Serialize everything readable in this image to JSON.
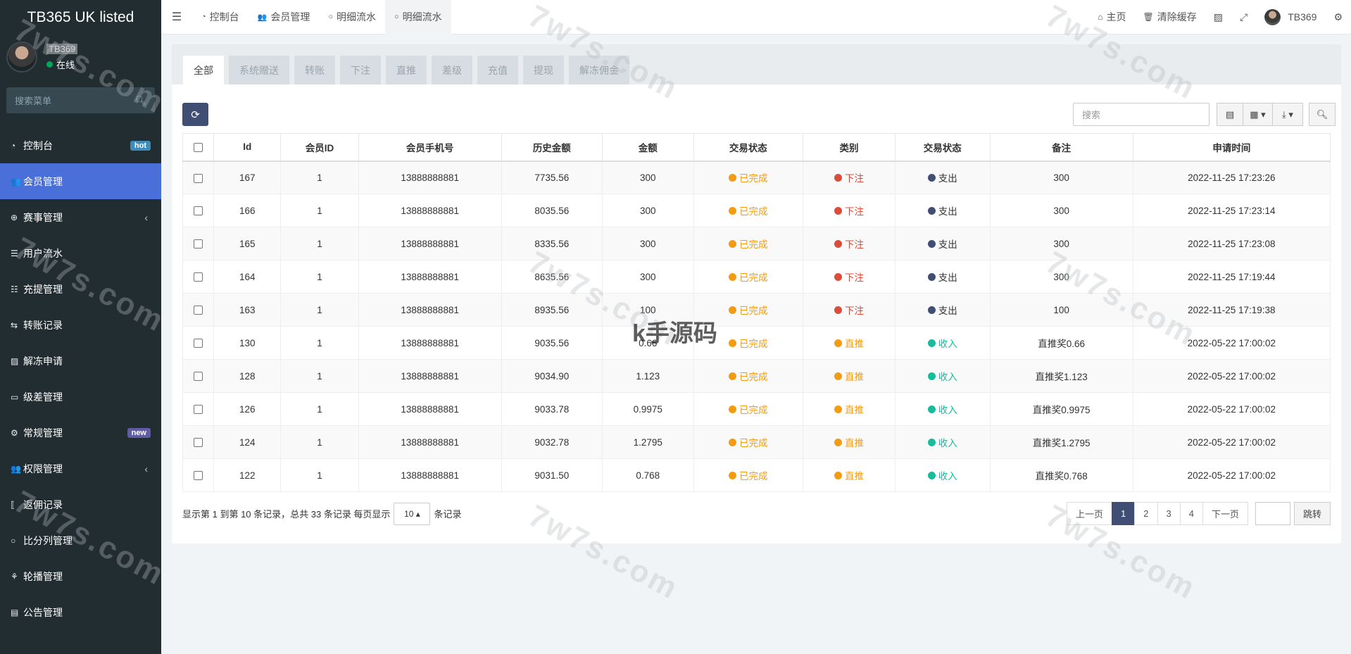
{
  "sidebar": {
    "brand": "TB365 UK listed",
    "user": {
      "name": "TB369",
      "status": "在线"
    },
    "search_placeholder": "搜索菜单",
    "items": [
      {
        "label": "控制台",
        "icon": "dashboard-icon",
        "glyph": "◔",
        "badge": "hot",
        "badge_type": "hot",
        "active": false,
        "chevron": false
      },
      {
        "label": "会员管理",
        "icon": "users-icon",
        "glyph": "👥",
        "badge": "",
        "active": true,
        "chevron": false
      },
      {
        "label": "赛事管理",
        "icon": "globe-icon",
        "glyph": "⊕",
        "badge": "",
        "active": false,
        "chevron": true
      },
      {
        "label": "用户流水",
        "icon": "list-icon",
        "glyph": "☰",
        "badge": "",
        "active": false,
        "chevron": false
      },
      {
        "label": "充提管理",
        "icon": "list-ordered-icon",
        "glyph": "☷",
        "badge": "",
        "active": false,
        "chevron": false
      },
      {
        "label": "转账记录",
        "icon": "transfer-icon",
        "glyph": "⇆",
        "badge": "",
        "active": false,
        "chevron": false
      },
      {
        "label": "解冻申请",
        "icon": "image-icon",
        "glyph": "▨",
        "badge": "",
        "active": false,
        "chevron": false
      },
      {
        "label": "级差管理",
        "icon": "window-icon",
        "glyph": "▭",
        "badge": "",
        "active": false,
        "chevron": false
      },
      {
        "label": "常规管理",
        "icon": "cogs-icon",
        "glyph": "⚙",
        "badge": "new",
        "badge_type": "new",
        "active": false,
        "chevron": false
      },
      {
        "label": "权限管理",
        "icon": "group-icon",
        "glyph": "👥",
        "badge": "",
        "active": false,
        "chevron": true
      },
      {
        "label": "返佣记录",
        "icon": "code-icon",
        "glyph": "⟦",
        "badge": "",
        "active": false,
        "chevron": false
      },
      {
        "label": "比分列管理",
        "icon": "circle-icon",
        "glyph": "○",
        "badge": "",
        "active": false,
        "chevron": false
      },
      {
        "label": "轮播管理",
        "icon": "sliders-icon",
        "glyph": "⚘",
        "badge": "",
        "active": false,
        "chevron": false
      },
      {
        "label": "公告管理",
        "icon": "newspaper-icon",
        "glyph": "▤",
        "badge": "",
        "active": false,
        "chevron": false
      }
    ]
  },
  "navbar": {
    "tabs": [
      {
        "label": "控制台",
        "icon": "dashboard-icon",
        "glyph": "◔",
        "active": false
      },
      {
        "label": "会员管理",
        "icon": "users-icon",
        "glyph": "👥",
        "active": false
      },
      {
        "label": "明细流水",
        "icon": "circle-icon",
        "glyph": "○",
        "active": false
      },
      {
        "label": "明细流水",
        "icon": "circle-icon",
        "glyph": "○",
        "active": true
      }
    ],
    "right": {
      "home": "主页",
      "clear_cache": "清除缓存",
      "user": "TB369"
    }
  },
  "filter_tabs": [
    "全部",
    "系统赠送",
    "转账",
    "下注",
    "直推",
    "差级",
    "充值",
    "提现",
    "解冻佣金"
  ],
  "toolbar": {
    "search_placeholder": "搜索"
  },
  "table": {
    "headers": [
      "Id",
      "会员ID",
      "会员手机号",
      "历史金额",
      "金额",
      "交易状态",
      "类别",
      "交易状态",
      "备注",
      "申请时间"
    ],
    "rows": [
      {
        "id": "167",
        "member_id": "1",
        "phone": "13888888881",
        "history": "7735.56",
        "amount": "300",
        "status": "已完成",
        "category": "下注",
        "direction": "支出",
        "note": "300",
        "time": "2022-11-25 17:23:26"
      },
      {
        "id": "166",
        "member_id": "1",
        "phone": "13888888881",
        "history": "8035.56",
        "amount": "300",
        "status": "已完成",
        "category": "下注",
        "direction": "支出",
        "note": "300",
        "time": "2022-11-25 17:23:14"
      },
      {
        "id": "165",
        "member_id": "1",
        "phone": "13888888881",
        "history": "8335.56",
        "amount": "300",
        "status": "已完成",
        "category": "下注",
        "direction": "支出",
        "note": "300",
        "time": "2022-11-25 17:23:08"
      },
      {
        "id": "164",
        "member_id": "1",
        "phone": "13888888881",
        "history": "8635.56",
        "amount": "300",
        "status": "已完成",
        "category": "下注",
        "direction": "支出",
        "note": "300",
        "time": "2022-11-25 17:19:44"
      },
      {
        "id": "163",
        "member_id": "1",
        "phone": "13888888881",
        "history": "8935.56",
        "amount": "100",
        "status": "已完成",
        "category": "下注",
        "direction": "支出",
        "note": "100",
        "time": "2022-11-25 17:19:38"
      },
      {
        "id": "130",
        "member_id": "1",
        "phone": "13888888881",
        "history": "9035.56",
        "amount": "0.66",
        "status": "已完成",
        "category": "直推",
        "direction": "收入",
        "note": "直推奖0.66",
        "time": "2022-05-22 17:00:02"
      },
      {
        "id": "128",
        "member_id": "1",
        "phone": "13888888881",
        "history": "9034.90",
        "amount": "1.123",
        "status": "已完成",
        "category": "直推",
        "direction": "收入",
        "note": "直推奖1.123",
        "time": "2022-05-22 17:00:02"
      },
      {
        "id": "126",
        "member_id": "1",
        "phone": "13888888881",
        "history": "9033.78",
        "amount": "0.9975",
        "status": "已完成",
        "category": "直推",
        "direction": "收入",
        "note": "直推奖0.9975",
        "time": "2022-05-22 17:00:02"
      },
      {
        "id": "124",
        "member_id": "1",
        "phone": "13888888881",
        "history": "9032.78",
        "amount": "1.2795",
        "status": "已完成",
        "category": "直推",
        "direction": "收入",
        "note": "直推奖1.2795",
        "time": "2022-05-22 17:00:02"
      },
      {
        "id": "122",
        "member_id": "1",
        "phone": "13888888881",
        "history": "9031.50",
        "amount": "0.768",
        "status": "已完成",
        "category": "直推",
        "direction": "收入",
        "note": "直推奖0.768",
        "time": "2022-05-22 17:00:02"
      }
    ]
  },
  "footer": {
    "summary": "显示第 1 到第 10 条记录，总共 33 条记录 每页显示",
    "page_size": "10",
    "suffix": "条记录",
    "prev": "上一页",
    "pages": [
      "1",
      "2",
      "3",
      "4"
    ],
    "current_page": "1",
    "next": "下一页",
    "jump": "跳转"
  },
  "watermarks": [
    "7w7s.com",
    "k手源码"
  ],
  "colors": {
    "sidebar_bg": "#222d32",
    "active_menu": "#4a6fd9",
    "accent": "#414e74",
    "status_done": "#f39c12",
    "category_bet": "#dd4b39",
    "category_direct": "#f39c12",
    "direction_out": "#414e74",
    "direction_in": "#18bc9c"
  }
}
